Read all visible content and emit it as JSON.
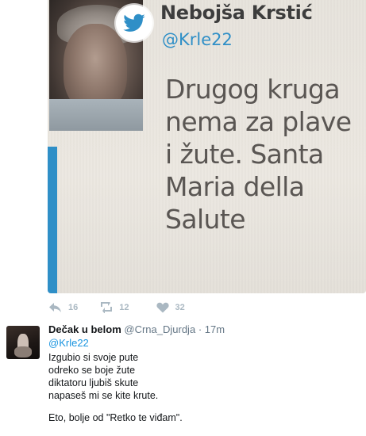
{
  "quoted_image": {
    "author_name": "Nebojša Krstić",
    "author_handle": "@Krle22",
    "text_lines": [
      "Drugog kruga",
      "nema za plave",
      "i žute. Santa",
      "Maria della",
      "Salute"
    ]
  },
  "actions": {
    "reply_count": "16",
    "retweet_count": "12",
    "like_count": "32",
    "icons": [
      "reply-icon",
      "retweet-icon",
      "heart-icon"
    ],
    "icon_color": "#aab8c2"
  },
  "reply": {
    "name": "Dečak u belom",
    "handle": "@Crna_Djurdja",
    "separator": "·",
    "time": "17m",
    "mention": "@Krle22",
    "lines": [
      "Izgubio si svoje pute",
      "odreko se boje žute",
      "diktatoru ljubiš skute",
      "napaseš mi se kite krute."
    ],
    "last_line": "Eto, bolje od \"Retko te viđam\"."
  },
  "colors": {
    "link": "#1b95e0",
    "twitter_blue": "#2f8fc7",
    "muted": "#657786"
  }
}
